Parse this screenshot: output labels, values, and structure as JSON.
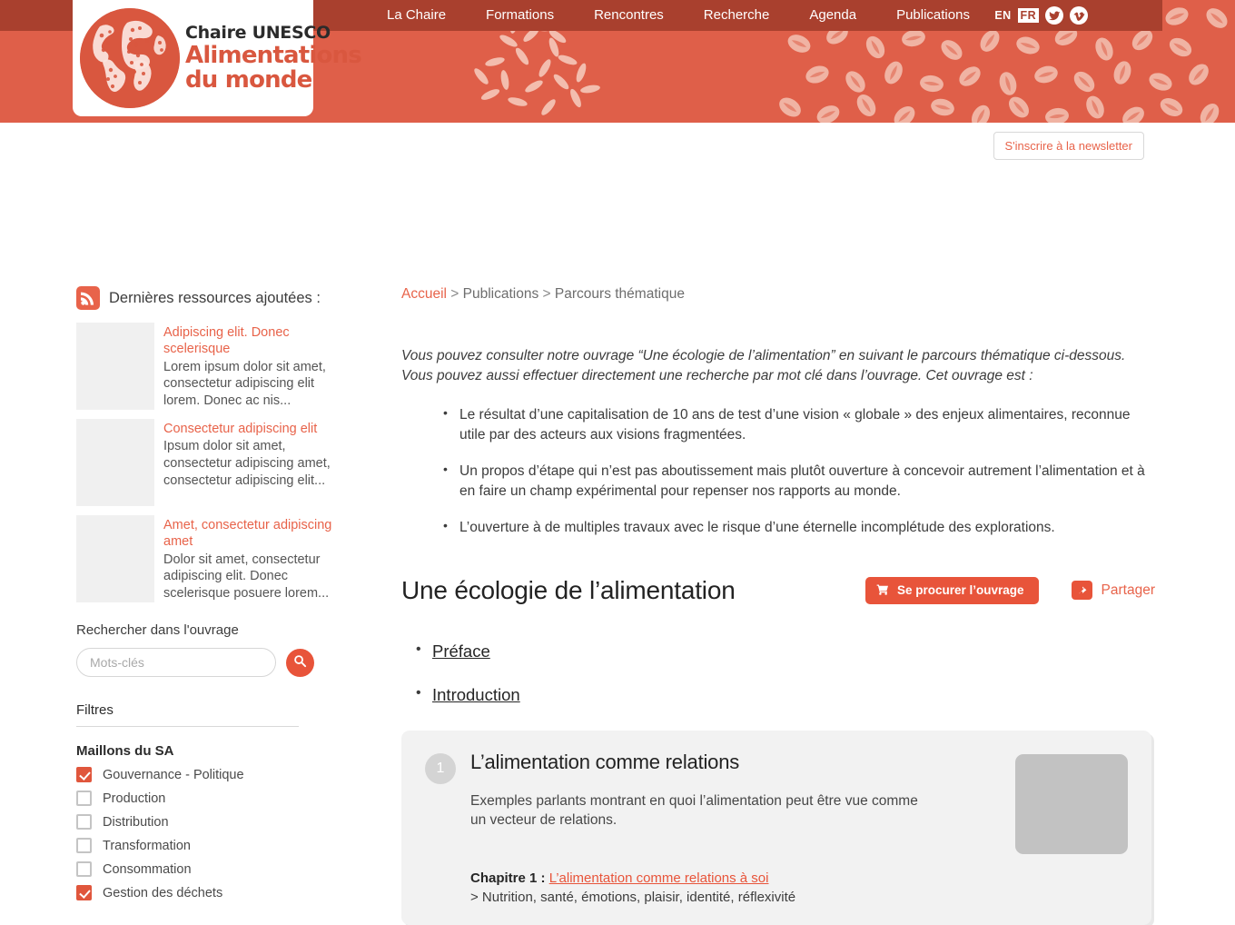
{
  "header": {
    "logo": {
      "line1": "Chaire UNESCO",
      "line2": "Alimentations",
      "line3": "du monde",
      "icon": "globe-logo-icon"
    },
    "nav": [
      {
        "label": "La Chaire"
      },
      {
        "label": "Formations"
      },
      {
        "label": "Rencontres"
      },
      {
        "label": "Recherche"
      },
      {
        "label": "Agenda"
      },
      {
        "label": "Publications"
      }
    ],
    "languages": [
      {
        "code": "EN",
        "active": false
      },
      {
        "code": "FR",
        "active": true
      }
    ],
    "social": [
      {
        "name": "twitter-icon"
      },
      {
        "name": "vimeo-icon"
      }
    ],
    "colors": {
      "navbar": "#a9402e",
      "banner": "#df5f49",
      "accent": "#e8543a",
      "link": "#e8634a"
    }
  },
  "newsletter": {
    "label": "S'inscrire à la newsletter"
  },
  "sidebar": {
    "rss": {
      "icon": "rss-icon",
      "title": "Dernières ressources ajoutées :"
    },
    "resources": [
      {
        "title": "Adipiscing elit. Donec scelerisque",
        "desc": "Lorem ipsum dolor sit amet, consectetur adipiscing elit lorem. Donec ac nis..."
      },
      {
        "title": "Consectetur adipiscing elit",
        "desc": "Ipsum dolor sit amet, consectetur adipiscing amet, consectetur adipiscing elit..."
      },
      {
        "title": "Amet, consectetur adipiscing amet",
        "desc": "Dolor sit amet, consectetur adipiscing elit. Donec scelerisque posuere lorem..."
      }
    ],
    "search": {
      "label": "Rechercher dans l'ouvrage",
      "placeholder": "Mots-clés",
      "value": "",
      "button_icon": "search-icon"
    },
    "filters": {
      "title": "Filtres",
      "group_title": "Maillons du SA",
      "items": [
        {
          "label": "Gouvernance - Politique",
          "checked": true
        },
        {
          "label": "Production",
          "checked": false
        },
        {
          "label": "Distribution",
          "checked": false
        },
        {
          "label": "Transformation",
          "checked": false
        },
        {
          "label": "Consommation",
          "checked": false
        },
        {
          "label": "Gestion des déchets",
          "checked": true
        }
      ]
    }
  },
  "main": {
    "breadcrumb": [
      {
        "label": "Accueil",
        "home": true
      },
      {
        "label": "Publications",
        "home": false
      },
      {
        "label": "Parcours thématique",
        "home": false
      }
    ],
    "breadcrumb_separator": ">",
    "intro": "Vous pouvez consulter notre ouvrage “Une écologie de l’alimentation” en suivant le parcours thématique ci-dessous. Vous pouvez aussi effectuer directement une recherche par mot clé dans l’ouvrage. Cet ouvrage est :",
    "bullets": [
      "Le résultat d’une capitalisation de 10 ans de test d’une vision « globale » des enjeux alimentaires, reconnue utile par des acteurs aux visions fragmentées.",
      "Un propos d’étape qui n’est pas aboutissement mais plutôt ouverture à concevoir autrement l’alimentation et à en faire un champ expérimental pour repenser nos rapports au monde.",
      "L’ouverture à de multiples travaux avec le risque d’une éternelle incomplétude des explorations."
    ],
    "work_title": "Une écologie de l’alimentation",
    "buy_button": {
      "label": "Se procurer l’ouvrage",
      "icon": "shopping-cart-icon"
    },
    "share_button": {
      "label": "Partager",
      "icon": "share-icon"
    },
    "toc": [
      {
        "label": "Préface"
      },
      {
        "label": "Introduction"
      }
    ],
    "chapter_card": {
      "number": "1",
      "title": "L’alimentation comme relations",
      "description": "Exemples parlants montrant en quoi l’alimentation peut être vue comme un vecteur de relations.",
      "entry_label": "Chapitre 1 :",
      "entry_link": "L’alimentation comme relations à soi",
      "entry_sub": "> Nutrition, santé, émotions, plaisir, identité, réflexivité"
    }
  }
}
